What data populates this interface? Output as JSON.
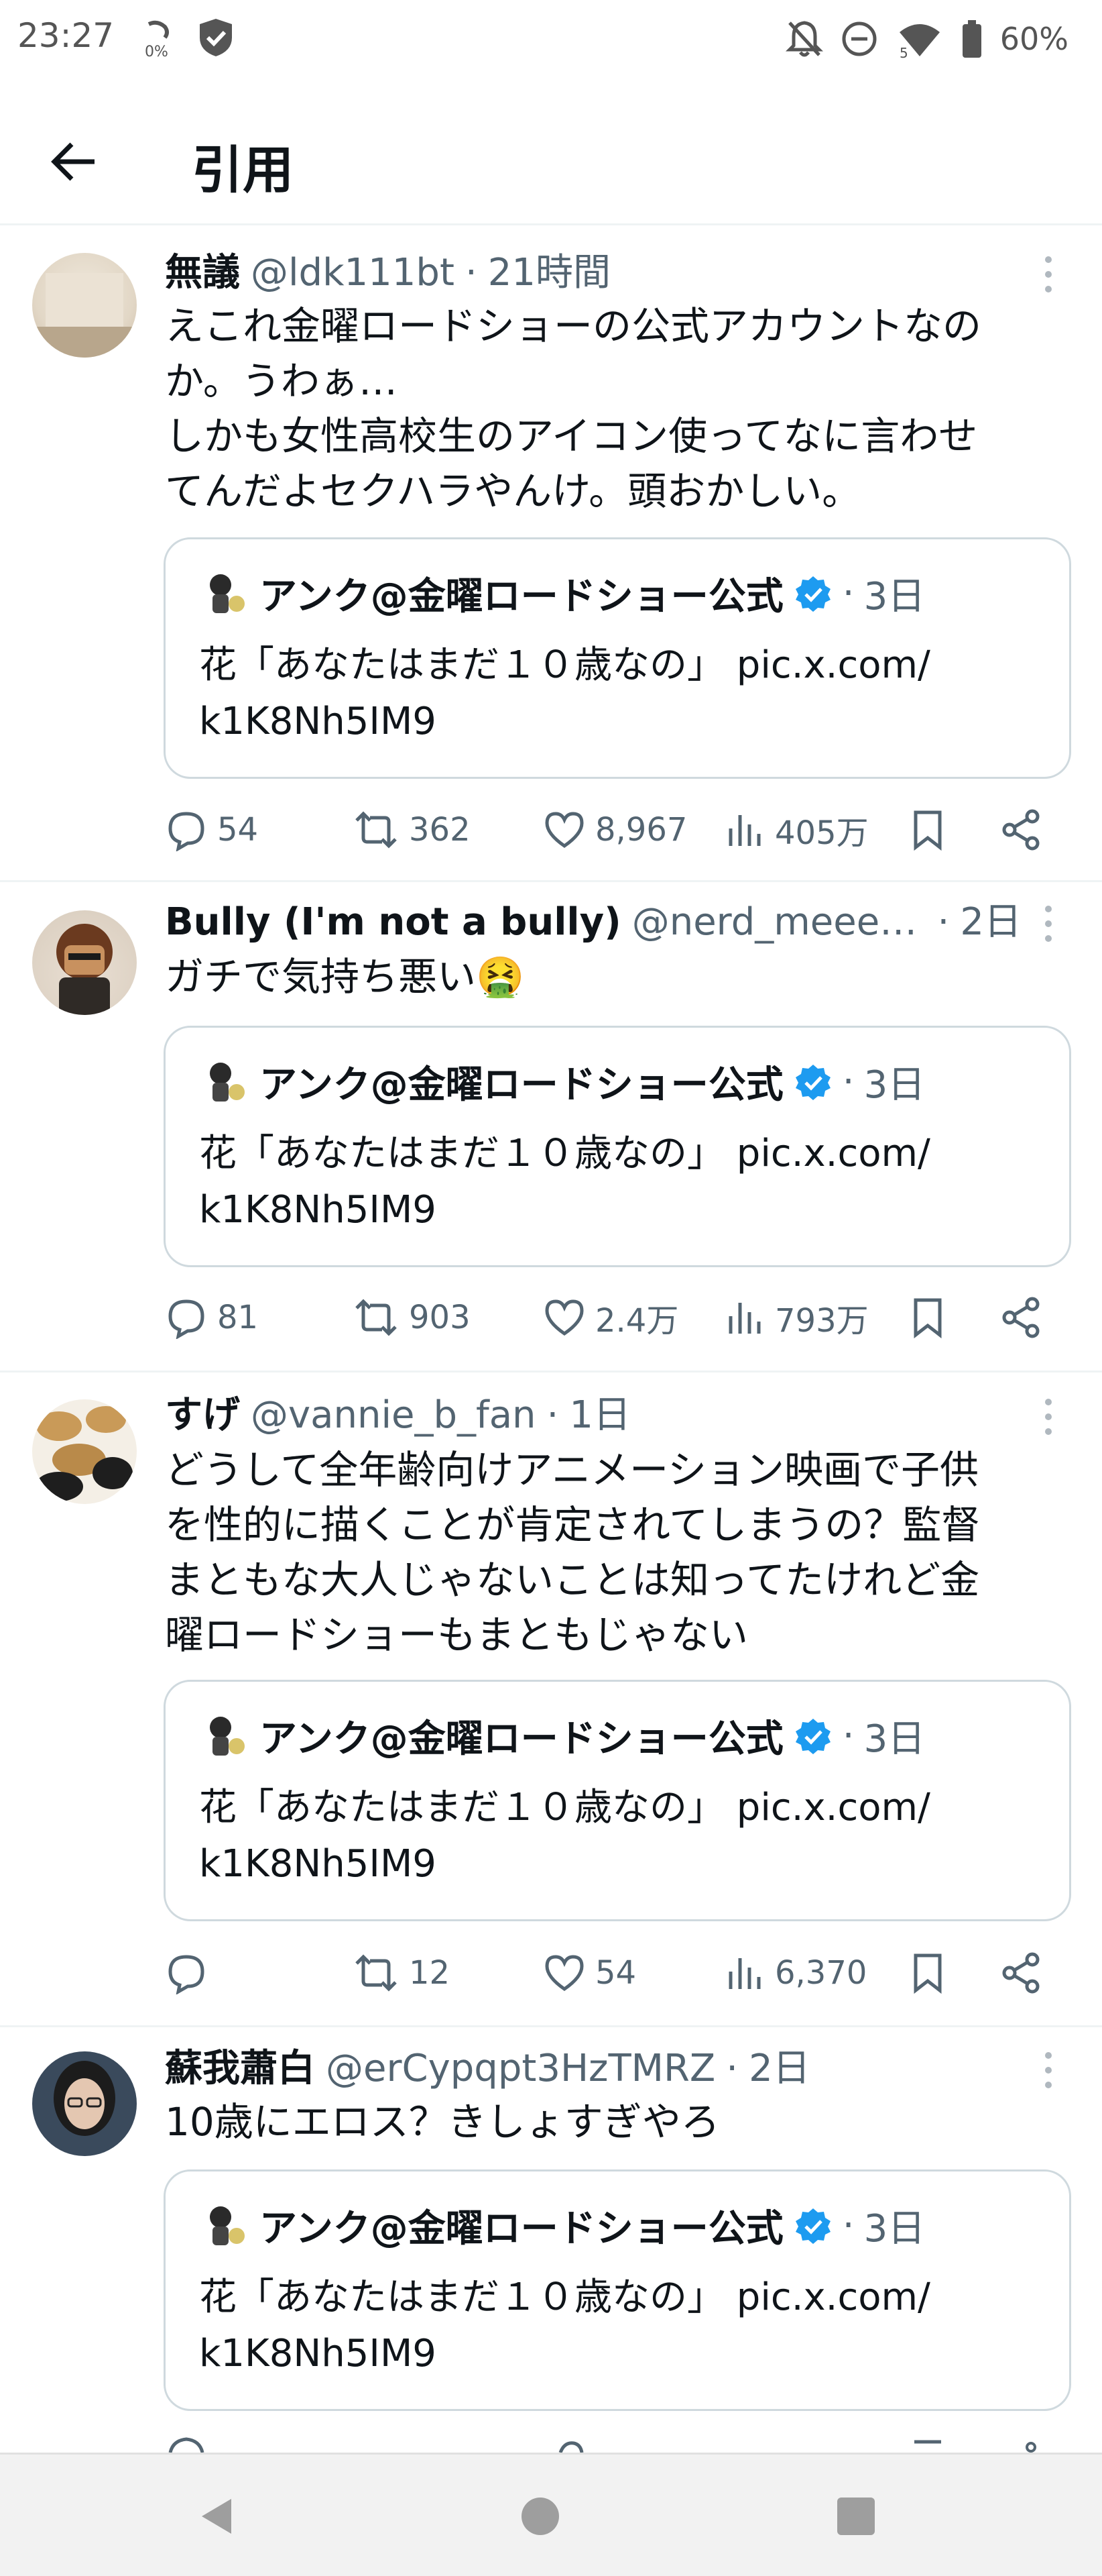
{
  "status_bar": {
    "time": "23:27",
    "data_indicator": "0%",
    "battery": "60%",
    "icons": [
      "data-saver-icon",
      "shield-icon",
      "notifications-off-icon",
      "do-not-disturb-icon",
      "wifi-icon",
      "battery-icon"
    ]
  },
  "header": {
    "title": "引用",
    "back_icon": "arrow-left-icon"
  },
  "quoted_tweet": {
    "name": "アンク@金曜ロードショー公式",
    "verified": true,
    "time": "3日",
    "text_line1": "花「あなたはまだ１０歳なの」 pic.x.com/",
    "text_line2": "k1K8Nh5IM9"
  },
  "tweets": [
    {
      "name": "無議",
      "handle": "@ldk111bt",
      "time": "21時間",
      "text": "えこれ金曜ロードショーの公式アカウントなの\nか。うわぁ…\nしかも女性高校生のアイコン使ってなに言わせ\nてんだよセクハラやんけ。頭おかしい。",
      "replies": "54",
      "retweets": "362",
      "likes": "8,967",
      "views": "405万"
    },
    {
      "name": "Bully (I'm not a bully)",
      "handle": "@nerd_meeee...",
      "time": "2日",
      "text": "ガチで気持ち悪い🤮",
      "replies": "81",
      "retweets": "903",
      "likes": "2.4万",
      "views": "793万"
    },
    {
      "name": "すげ",
      "handle": "@vannie_b_fan",
      "time": "1日",
      "text": "どうして全年齢向けアニメーション映画で子供\nを性的に描くことが肯定されてしまうの？監督\nまともな大人じゃないことは知ってたけれど金\n曜ロードショーもまともじゃない",
      "replies": "",
      "retweets": "12",
      "likes": "54",
      "views": "6,370"
    },
    {
      "name": "蘇我蕭白",
      "handle": "@erCypqpt3HzTMRZ",
      "time": "2日",
      "text": "10歳にエロス？きしょすぎやろ"
    }
  ],
  "separator": "·",
  "colors": {
    "text_primary": "#0f1419",
    "text_secondary": "#536471",
    "verified_blue": "#1d9bf0",
    "border": "#cfd9de",
    "divider": "#eff3f4"
  },
  "nav_bar": {
    "icons": [
      "back-triangle-icon",
      "home-circle-icon",
      "recents-square-icon"
    ]
  }
}
